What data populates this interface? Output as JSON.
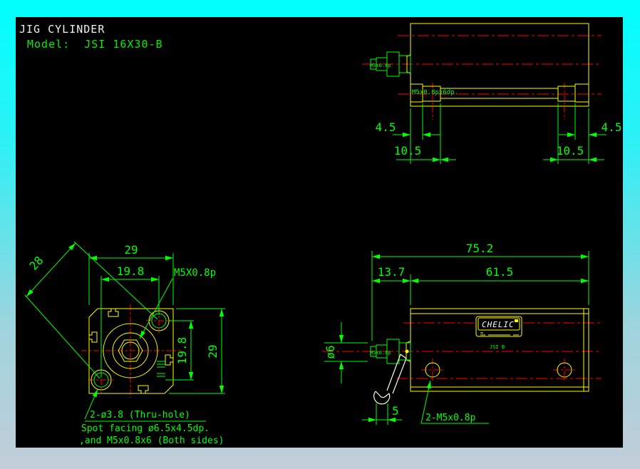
{
  "title": "JIG CYLINDER",
  "model": "Model:  JSI 16X30-B",
  "colors": {
    "background": "#000000",
    "frame_top": "#00ffff",
    "frame_bottom": "#c2cdd8",
    "geometry": "#ffff00",
    "dimension": "#00ff00",
    "centerline": "#ff0000",
    "title_text": "#f0f0f0",
    "model_text": "#00f000"
  },
  "top_view": {
    "rod_thread_label": "M5x0.8p",
    "plate_thread_label": "M5x0.8px6dp.",
    "dim_foot_offset_left": "4.5",
    "dim_foot_pitch_left": "10.5",
    "dim_foot_offset_right": "4.5",
    "dim_foot_pitch_right": "10.5"
  },
  "front_view": {
    "dim_width": "29",
    "dim_bolt_spacing_h": "19.8",
    "rod_thread_label": "M5X0.8p",
    "dim_bolt_diagonal": "28",
    "dim_bolt_spacing_v": "19.8",
    "dim_height": "29",
    "hole_note_1": "2-ø3.8 (Thru-hole)",
    "hole_note_2": "Spot facing ø6.5x4.5dp.",
    "hole_note_3": ",and M5x0.8x6 (Both sides)"
  },
  "side_view": {
    "dim_total_length": "75.2",
    "dim_rod_end": "13.7",
    "dim_body_length": "61.5",
    "dim_rod_diameter": "ø6",
    "dim_wrench_flat": "5",
    "port_label": "2-M5x0.8p",
    "rod_thread_label": "M5x0.8p",
    "brand": "CHELIC",
    "part_tag": "JSI B"
  }
}
